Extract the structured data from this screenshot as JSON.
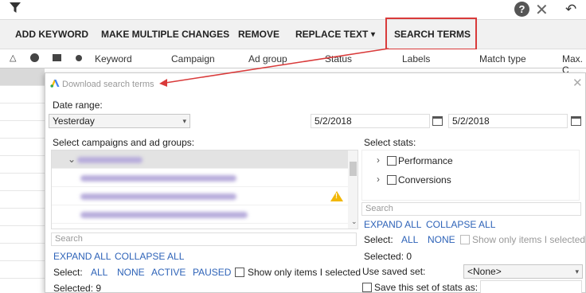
{
  "toolbar": {
    "add_keyword": "ADD KEYWORD",
    "make_multiple_changes": "MAKE MULTIPLE CHANGES",
    "remove": "REMOVE",
    "replace_text": "REPLACE TEXT",
    "dropdown_caret": "▾",
    "search_terms": "SEARCH TERMS"
  },
  "columns": [
    "Keyword",
    "Campaign",
    "Ad group",
    "Status",
    "Labels",
    "Match type",
    "Max. C"
  ],
  "dialog": {
    "title": "Download search terms",
    "date_range_label": "Date range:",
    "date_range_value": "Yesterday",
    "start_date": "5/2/2018",
    "end_date": "5/2/2018",
    "campaigns_label": "Select campaigns and ad groups:",
    "stats_label": "Select stats:",
    "stats_items": [
      "Performance",
      "Conversions"
    ],
    "left_search_placeholder": "Search",
    "right_search_placeholder": "Search",
    "expand_all": "EXPAND ALL",
    "collapse_all": "COLLAPSE ALL",
    "select_label": "Select:",
    "all": "ALL",
    "none": "NONE",
    "active": "ACTIVE",
    "paused": "PAUSED",
    "show_only_selected": "Show only items I selected",
    "left_selected": "Selected: 9",
    "right_selected": "Selected: 0",
    "use_saved_set": "Use saved set:",
    "saved_set_value": "<None>",
    "save_set_as": "Save this set of stats as:"
  },
  "colors": {
    "highlight": "#d93a3a",
    "link": "#2e63b8"
  }
}
